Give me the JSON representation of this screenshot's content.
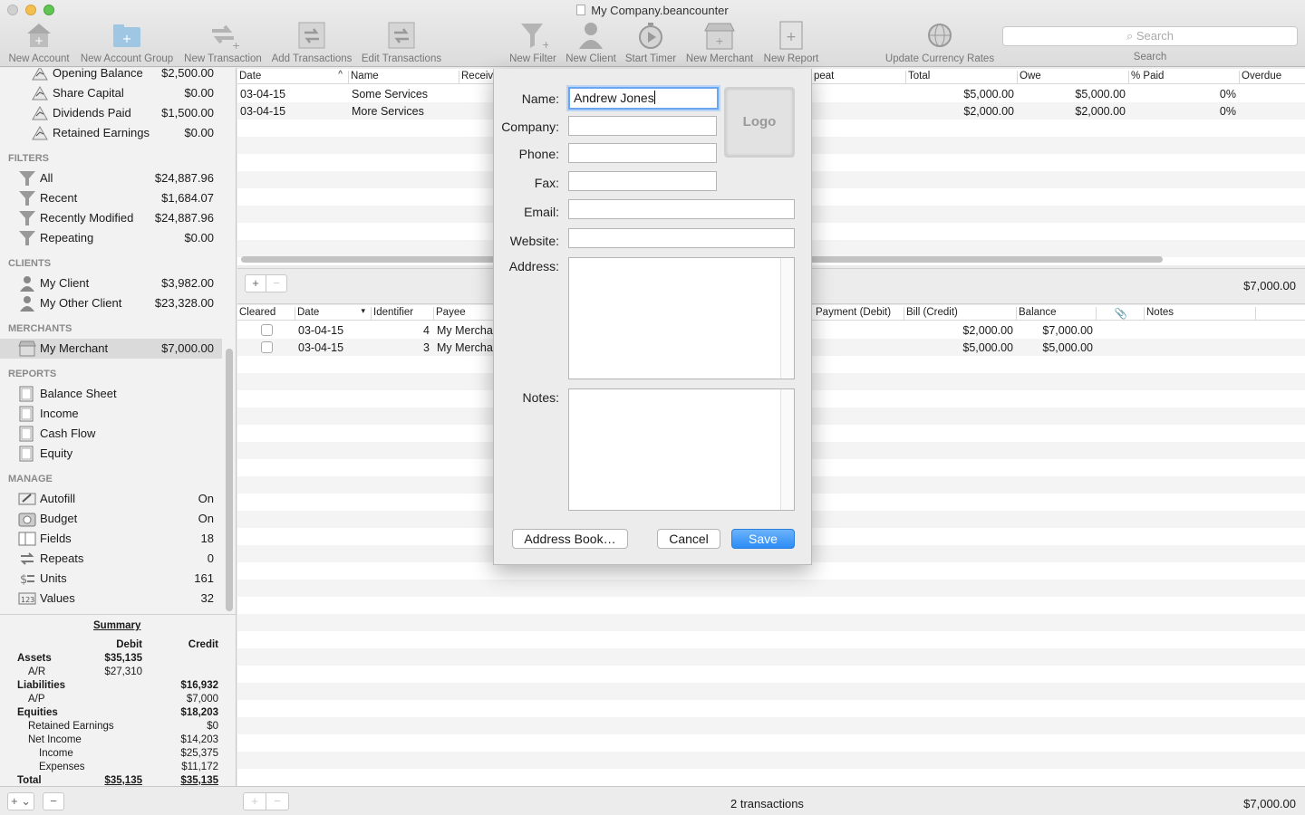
{
  "window": {
    "title": "My Company.beancounter"
  },
  "toolbar": {
    "items": [
      {
        "label": "New Account",
        "icon": "new-account-icon"
      },
      {
        "label": "New Account Group",
        "icon": "new-account-group-icon"
      },
      {
        "label": "New Transaction",
        "icon": "new-transaction-icon"
      },
      {
        "label": "Add Transactions",
        "icon": "add-transactions-icon"
      },
      {
        "label": "Edit Transactions",
        "icon": "edit-transactions-icon"
      },
      {
        "label": "New Filter",
        "icon": "filter-icon"
      },
      {
        "label": "New Client",
        "icon": "client-icon"
      },
      {
        "label": "Start Timer",
        "icon": "timer-icon"
      },
      {
        "label": "New Merchant",
        "icon": "merchant-icon"
      },
      {
        "label": "New Report",
        "icon": "report-icon"
      },
      {
        "label": "Update Currency Rates",
        "icon": "globe-icon"
      }
    ],
    "search_placeholder": "Search",
    "search_label": "Search"
  },
  "sidebar": {
    "equity_items": [
      {
        "label": "Opening Balance",
        "value": "$2,500.00"
      },
      {
        "label": "Share Capital",
        "value": "$0.00"
      },
      {
        "label": "Dividends Paid",
        "value": "$1,500.00"
      },
      {
        "label": "Retained Earnings",
        "value": "$0.00"
      }
    ],
    "filters_heading": "FILTERS",
    "filters": [
      {
        "label": "All",
        "value": "$24,887.96"
      },
      {
        "label": "Recent",
        "value": "$1,684.07"
      },
      {
        "label": "Recently Modified",
        "value": "$24,887.96"
      },
      {
        "label": "Repeating",
        "value": "$0.00"
      }
    ],
    "clients_heading": "CLIENTS",
    "clients": [
      {
        "label": "My Client",
        "value": "$3,982.00"
      },
      {
        "label": "My Other Client",
        "value": "$23,328.00"
      }
    ],
    "merchants_heading": "MERCHANTS",
    "merchants": [
      {
        "label": "My Merchant",
        "value": "$7,000.00"
      }
    ],
    "reports_heading": "REPORTS",
    "reports": [
      {
        "label": "Balance Sheet"
      },
      {
        "label": "Income"
      },
      {
        "label": "Cash Flow"
      },
      {
        "label": "Equity"
      }
    ],
    "manage_heading": "MANAGE",
    "manage": [
      {
        "label": "Autofill",
        "value": "On"
      },
      {
        "label": "Budget",
        "value": "On"
      },
      {
        "label": "Fields",
        "value": "18"
      },
      {
        "label": "Repeats",
        "value": "0"
      },
      {
        "label": "Units",
        "value": "161"
      },
      {
        "label": "Values",
        "value": "32"
      }
    ]
  },
  "summary": {
    "title": "Summary",
    "debit_header": "Debit",
    "credit_header": "Credit",
    "rows": [
      {
        "label": "Assets",
        "debit": "$35,135",
        "credit": ""
      },
      {
        "label": "A/R",
        "debit": "$27,310",
        "credit": ""
      },
      {
        "label": "Liabilities",
        "debit": "",
        "credit": "$16,932"
      },
      {
        "label": "A/P",
        "debit": "",
        "credit": "$7,000"
      },
      {
        "label": "Equities",
        "debit": "",
        "credit": "$18,203"
      },
      {
        "label": "Retained Earnings",
        "debit": "",
        "credit": "$0"
      },
      {
        "label": "Net Income",
        "debit": "",
        "credit": "$14,203"
      },
      {
        "label": "Income",
        "debit": "",
        "credit": "$25,375"
      },
      {
        "label": "Expenses",
        "debit": "",
        "credit": "$11,172"
      },
      {
        "label": "Total",
        "debit": "$35,135",
        "credit": "$35,135"
      }
    ]
  },
  "top_table": {
    "headers": {
      "date": "Date",
      "name": "Name",
      "receive": "Receiv",
      "repeat": "peat",
      "total": "Total",
      "owe": "Owe",
      "paid": "% Paid",
      "overdue": "Overdue"
    },
    "rows": [
      {
        "date": "03-04-15",
        "name": "Some Services",
        "total": "$5,000.00",
        "owe": "$5,000.00",
        "paid": "0%"
      },
      {
        "date": "03-04-15",
        "name": "More Services",
        "total": "$2,000.00",
        "owe": "$2,000.00",
        "paid": "0%"
      }
    ],
    "footer_total": "$7,000.00"
  },
  "bottom_table": {
    "headers": {
      "cleared": "Cleared",
      "date": "Date",
      "identifier": "Identifier",
      "payee": "Payee",
      "payment": "Payment (Debit)",
      "bill": "Bill (Credit)",
      "balance": "Balance",
      "notes": "Notes"
    },
    "rows": [
      {
        "identifier": "4",
        "date": "03-04-15",
        "payee": "My Mercha",
        "bill": "$2,000.00",
        "balance": "$7,000.00"
      },
      {
        "identifier": "3",
        "date": "03-04-15",
        "payee": "My Mercha",
        "bill": "$5,000.00",
        "balance": "$5,000.00"
      }
    ]
  },
  "status": {
    "count": "2 transactions",
    "total": "$7,000.00"
  },
  "dialog": {
    "name_label": "Name:",
    "name_value": "Andrew Jones",
    "company_label": "Company:",
    "phone_label": "Phone:",
    "fax_label": "Fax:",
    "email_label": "Email:",
    "website_label": "Website:",
    "address_label": "Address:",
    "notes_label": "Notes:",
    "logo_text": "Logo",
    "address_book_button": "Address Book…",
    "cancel_button": "Cancel",
    "save_button": "Save"
  },
  "colors": {
    "accent": "#2c8cf5",
    "selected_row": "#dadada",
    "stripe": "#f4f4f4"
  }
}
